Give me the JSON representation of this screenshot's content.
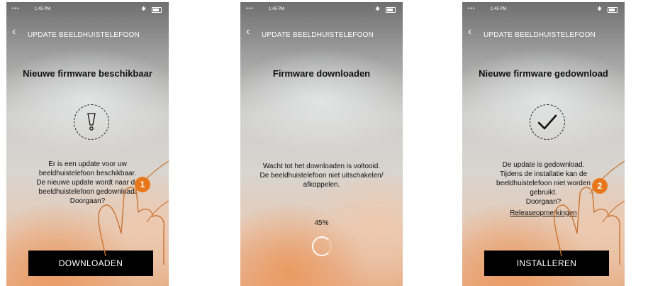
{
  "statusbar": {
    "time": "1:45 PM",
    "signal_dots": "•••"
  },
  "screens": [
    {
      "nav_title": "UPDATE BEELDHUISTELEFOON",
      "headline": "Nieuwe firmware beschikbaar",
      "icon": "exclamation-icon",
      "message_lines": [
        "Er is een update voor uw",
        "beeldhuistelefoon beschikbaar.",
        "De nieuwe update wordt naar de",
        "beeldhuistelefoon gedownload.",
        "Doorgaan?"
      ],
      "button": "DOWNLOADEN",
      "step": "1"
    },
    {
      "nav_title": "UPDATE BEELDHUISTELEFOON",
      "headline": "Firmware downloaden",
      "message_lines": [
        "Wacht tot het downloaden is voltooid.",
        "De beeldhuistelefoon niet uitschakelen/",
        "afkoppelen."
      ],
      "progress": "45%"
    },
    {
      "nav_title": "UPDATE BEELDHUISTELEFOON",
      "headline": "Nieuwe firmware gedownload",
      "icon": "checkmark-icon",
      "message_lines": [
        "De update is gedownload.",
        "Tijdens de installatie kan de",
        "beeldhuistelefoon niet worden",
        "gebruikt.",
        "Doorgaan?"
      ],
      "link": "Releaseopmerkingen",
      "button": "INSTALLEREN",
      "step": "2"
    }
  ],
  "colors": {
    "badge": "#e8761b",
    "button_bg": "#000000",
    "hand_stroke": "#c9722f"
  }
}
